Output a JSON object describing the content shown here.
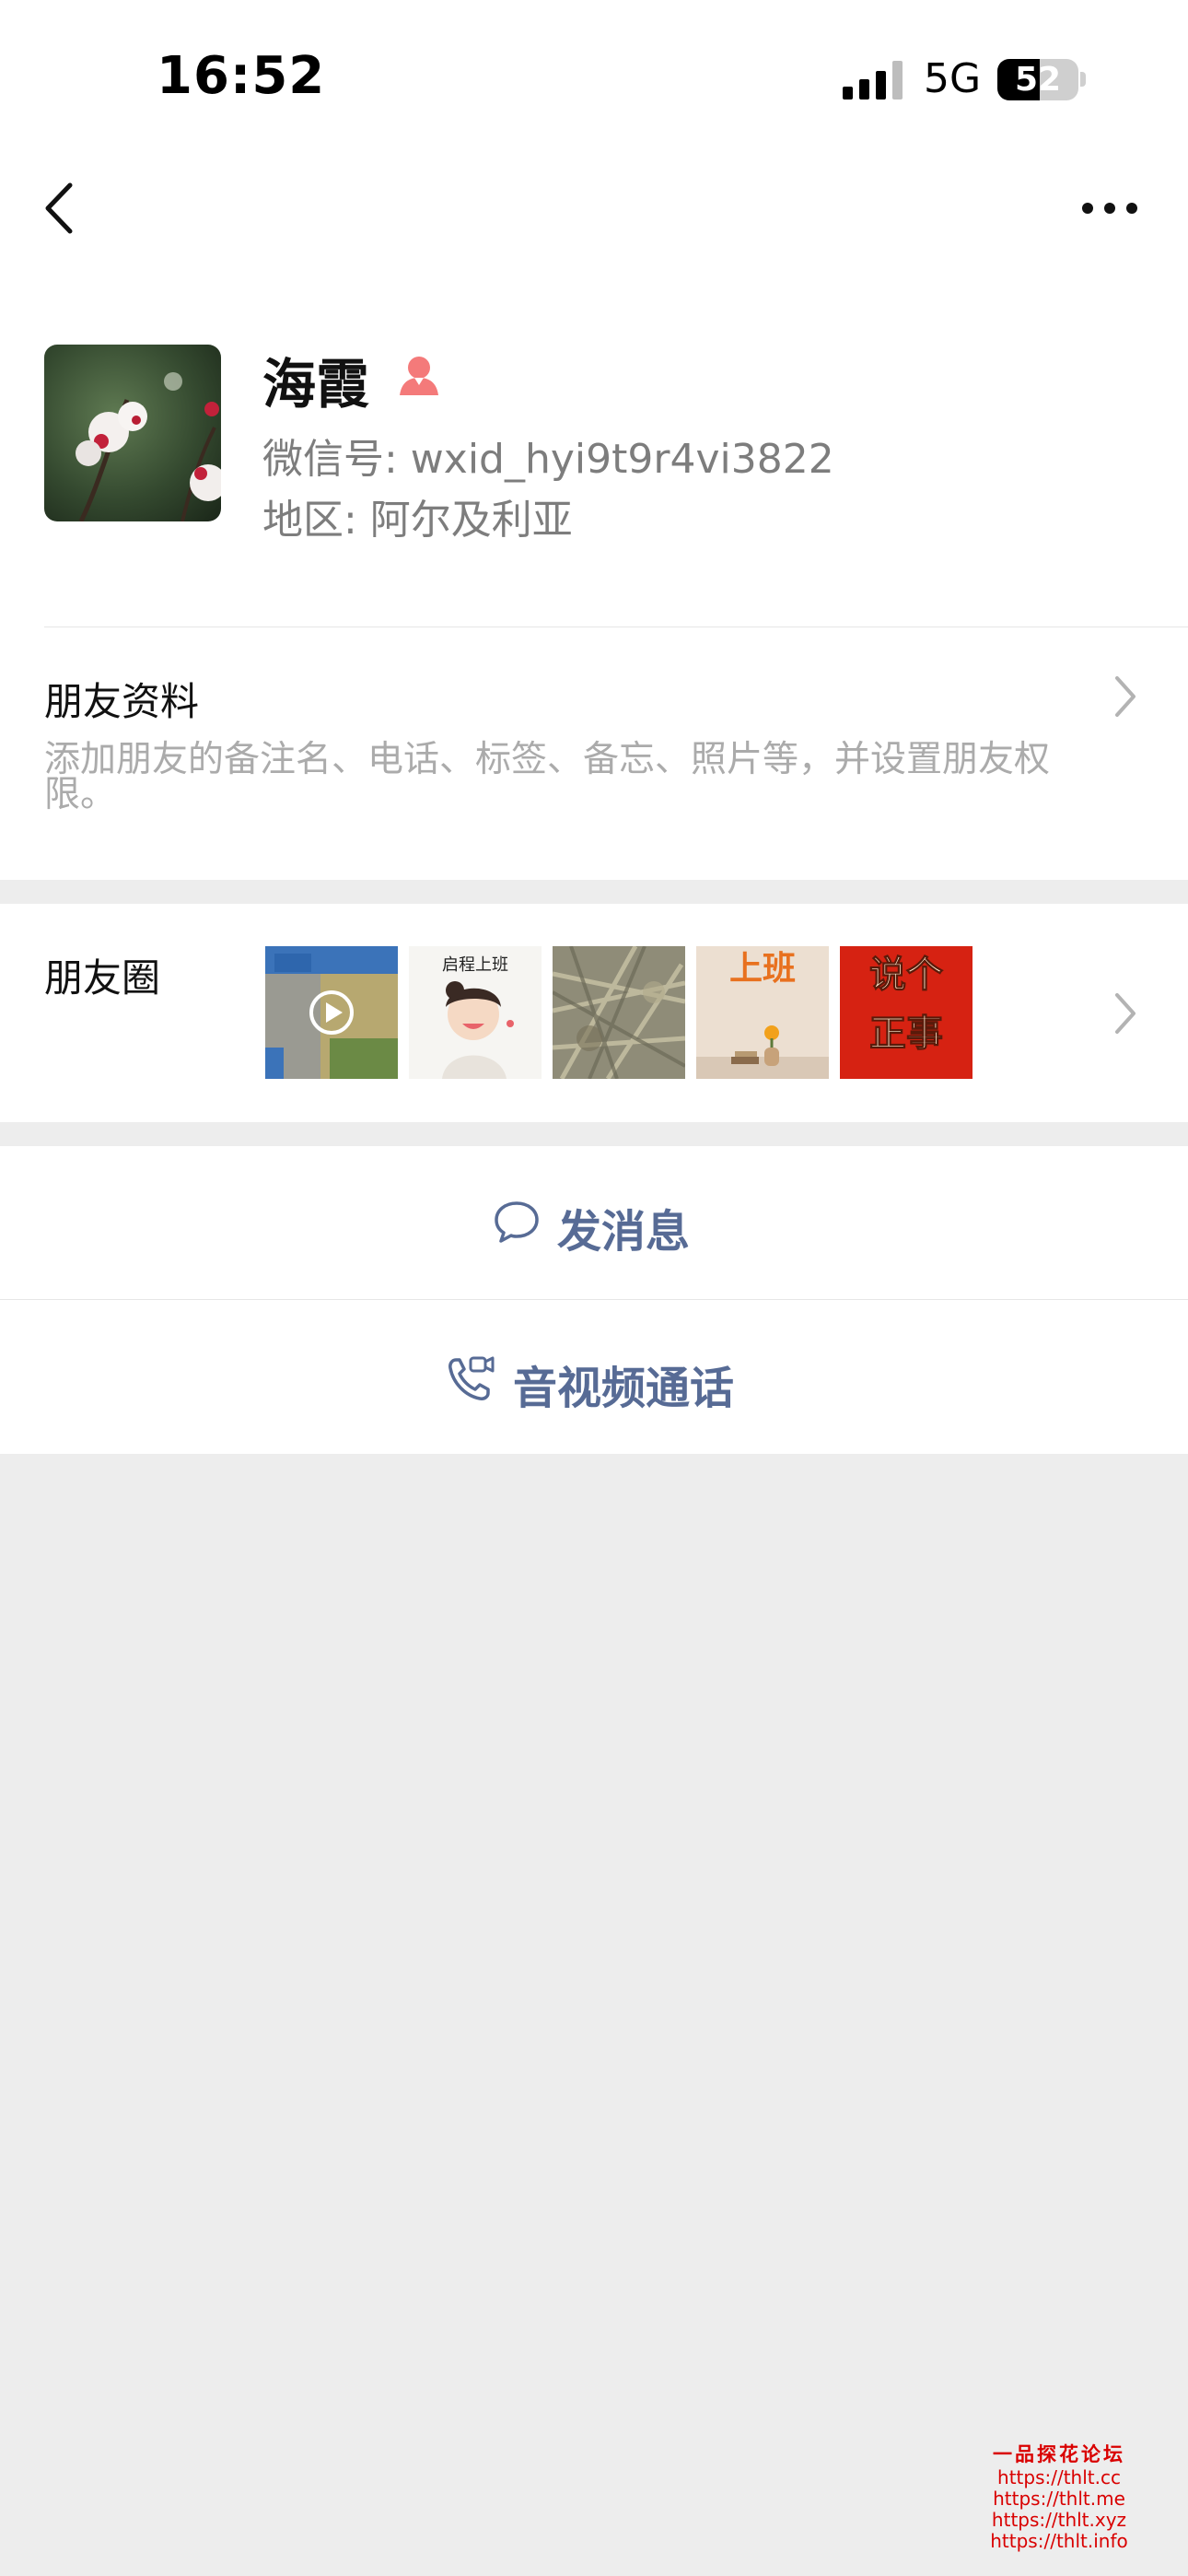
{
  "status_bar": {
    "time": "16:52",
    "network": "5G",
    "battery": "52",
    "battery_level": 0.52
  },
  "nav": {
    "back_icon": "chevron-left-icon",
    "more_icon": "more-horizontal-icon"
  },
  "profile": {
    "name": "海霞",
    "wechat_id": "微信号: wxid_hyi9t9r4vi3822",
    "region": "地区: 阿尔及利亚",
    "gender_icon": "female-icon"
  },
  "friend_info": {
    "title": "朋友资料",
    "description": "添加朋友的备注名、电话、标签、备忘、照片等，并设置朋友权限。"
  },
  "moments": {
    "title": "朋友圈",
    "thumbnails": [
      {
        "label": "",
        "icon": "play-icon"
      },
      {
        "label": "启程上班"
      },
      {
        "label": ""
      },
      {
        "label": "上班"
      },
      {
        "label": "说个\n正事"
      }
    ]
  },
  "actions": {
    "send_message": "发消息",
    "av_call": "音视频通话"
  },
  "watermark": {
    "title": "一品探花论坛",
    "urls": [
      "https://thlt.cc",
      "https://thlt.me",
      "https://thlt.xyz",
      "https://thlt.info"
    ]
  },
  "colors": {
    "link": "#576b95",
    "background": "#ededed",
    "gender": "#f47a7a",
    "watermark": "#d90000"
  }
}
